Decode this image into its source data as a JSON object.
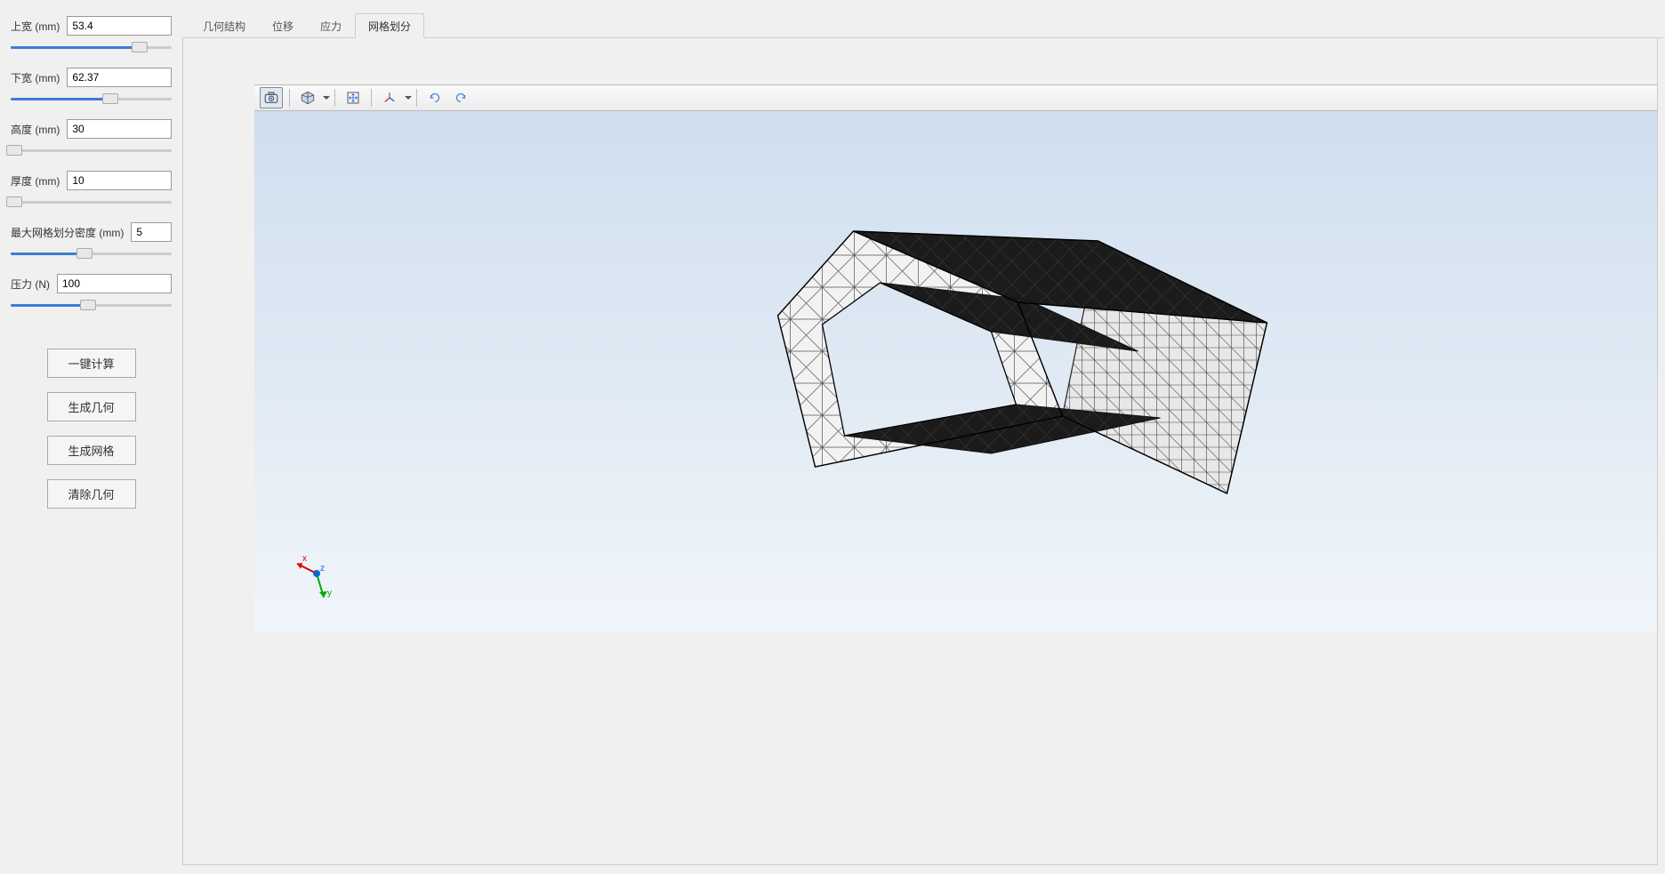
{
  "sidebar": {
    "params": [
      {
        "label": "上宽 (mm)",
        "value": "53.4",
        "slider_pct": 80
      },
      {
        "label": "下宽 (mm)",
        "value": "62.37",
        "slider_pct": 62
      },
      {
        "label": "高度 (mm)",
        "value": "30",
        "slider_pct": 2
      },
      {
        "label": "厚度 (mm)",
        "value": "10",
        "slider_pct": 2
      },
      {
        "label": "最大网格划分密度 (mm)",
        "value": "5",
        "slider_pct": 46
      },
      {
        "label": "压力 (N)",
        "value": "100",
        "slider_pct": 48
      }
    ],
    "buttons": {
      "calc": "一键计算",
      "gen_geom": "生成几何",
      "gen_mesh": "生成网格",
      "clear_geom": "清除几何"
    }
  },
  "tabs": {
    "items": [
      "几何结构",
      "位移",
      "应力",
      "网格划分"
    ],
    "active_index": 3
  },
  "toolbar": {
    "icons": [
      "camera",
      "cube",
      "pan",
      "axes",
      "rotate-ccw",
      "rotate-cw"
    ]
  },
  "axes": {
    "x": "x",
    "y": "y",
    "z": "z"
  }
}
